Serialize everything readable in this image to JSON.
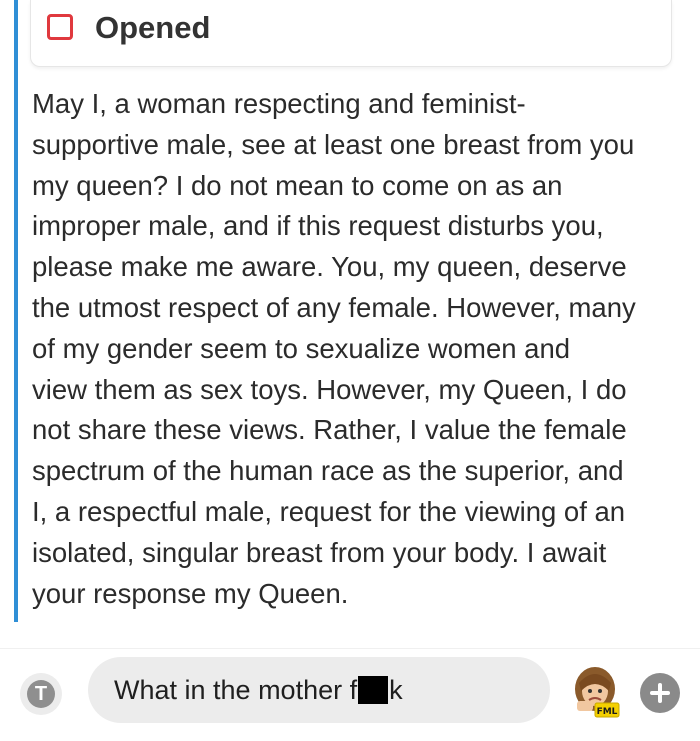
{
  "status": {
    "label": "Opened",
    "color": "#e0393e"
  },
  "message": {
    "accent_color": "#2f8fd6",
    "lines": [
      "May I, a woman respecting and feminist-",
      "supportive male, see at least one breast from you",
      "my queen? I do not mean to come on as an",
      "improper male, and if this request disturbs you,",
      "please make me aware. You, my queen, deserve",
      "the utmost respect of any female. However, many",
      "of my gender seem to sexualize women and",
      "view them as sex toys. However, my Queen, I do",
      "not share these views. Rather, I value the female",
      "spectrum of the human race as the superior, and",
      "I, a respectful male, request for the viewing of an",
      "isolated, singular breast from your body. I await",
      "your response my Queen."
    ]
  },
  "composer": {
    "t_icon_label": "T",
    "input_text_before": "What in the mother f",
    "input_text_after": "k",
    "bitmoji_label": "FML",
    "icons": {
      "text_style": "text-style-icon",
      "bitmoji": "bitmoji-icon",
      "add": "plus-icon"
    }
  }
}
